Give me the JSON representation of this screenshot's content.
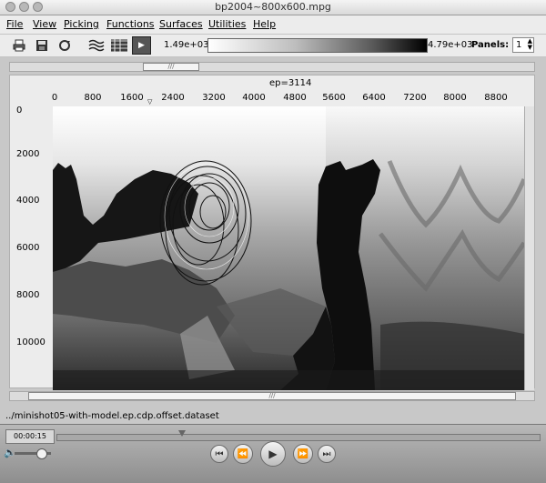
{
  "window": {
    "title": "bp2004~800x600.mpg"
  },
  "menu": [
    "File",
    "View",
    "Picking",
    "Functions",
    "Surfaces",
    "Utilities",
    "Help"
  ],
  "toolbar": {
    "colorbar_min": "1.49e+03",
    "colorbar_max": "4.79e+03",
    "panels_label": "Panels:",
    "panels_value": "1"
  },
  "plot": {
    "title": "ep=3114",
    "x_ticks": [
      "0",
      "800",
      "1600",
      "2400",
      "3200",
      "4000",
      "4800",
      "5600",
      "6400",
      "7200",
      "8000",
      "8800"
    ],
    "y_ticks": [
      "0",
      "2000",
      "4000",
      "6000",
      "8000",
      "10000"
    ]
  },
  "status": {
    "dataset": "../minishot05-with-model.ep.cdp.offset.dataset"
  },
  "player": {
    "time": "00:00:15"
  },
  "icons": [
    "print-icon",
    "save-icon",
    "refresh-icon",
    "wiggle-icon",
    "density-icon",
    "play-icon",
    "volume-icon"
  ]
}
